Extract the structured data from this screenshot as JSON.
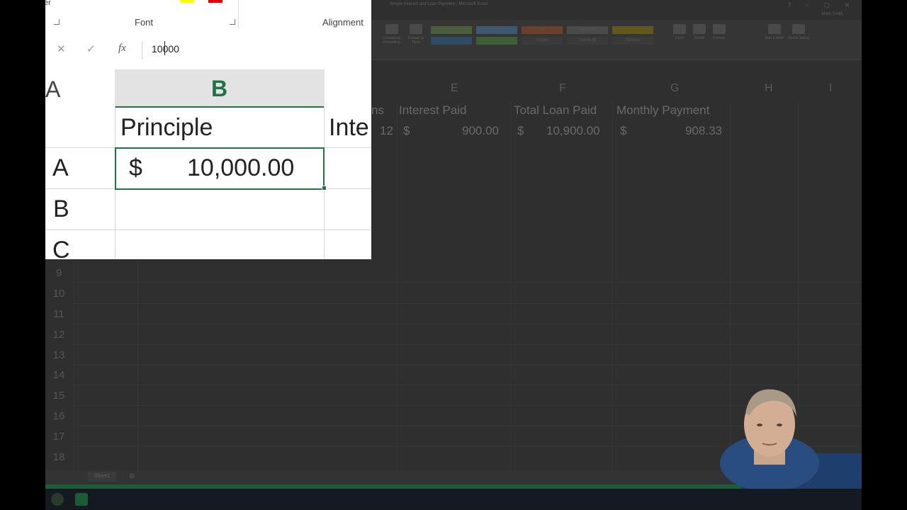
{
  "background": {
    "title_text": "Simple Interest and Loan Payment - Microsoft Excel",
    "user_text": "Mark Smith",
    "ribbon": {
      "buttons": [
        "Conditional Formatting",
        "Format as Table",
        "Insert",
        "Delete",
        "Format",
        "Sort & Filter",
        "Find & Select"
      ],
      "styles": [
        "Good",
        "Neutral",
        "Bad",
        "Calculation",
        "Comma",
        "Comma [0]",
        "Currency"
      ]
    },
    "column_headers": [
      "E",
      "F",
      "G",
      "H",
      "I"
    ],
    "row_numbers": [
      "9",
      "10",
      "11",
      "12",
      "13",
      "14",
      "15",
      "16",
      "17",
      "18"
    ],
    "cells": {
      "d1_partial": "ns",
      "e1": "Interest Paid",
      "f1": "Total Loan Paid",
      "g1": "Monthly Payment",
      "d2": "12",
      "e2_symbol": "$",
      "e2_value": "900.00",
      "f2_symbol": "$",
      "f2_value": "10,900.00",
      "g2_symbol": "$",
      "g2_value": "908.33"
    },
    "sheet_tab": "Sheet1"
  },
  "zoom": {
    "ribbon_groups": {
      "font": "Font",
      "alignment": "Alignment",
      "clipboard_partial": "er"
    },
    "formula_bar": {
      "cancel": "✕",
      "enter": "✓",
      "fx": "fx",
      "value": "10000"
    },
    "column_headers": {
      "a": "A",
      "b": "B"
    },
    "row_headers": [
      "A",
      "B",
      "C"
    ],
    "b1": "Principle",
    "c1_partial": "Inte",
    "b2_symbol": "$",
    "b2_value": "10,000.00"
  },
  "colors": {
    "accent": "#217346"
  }
}
